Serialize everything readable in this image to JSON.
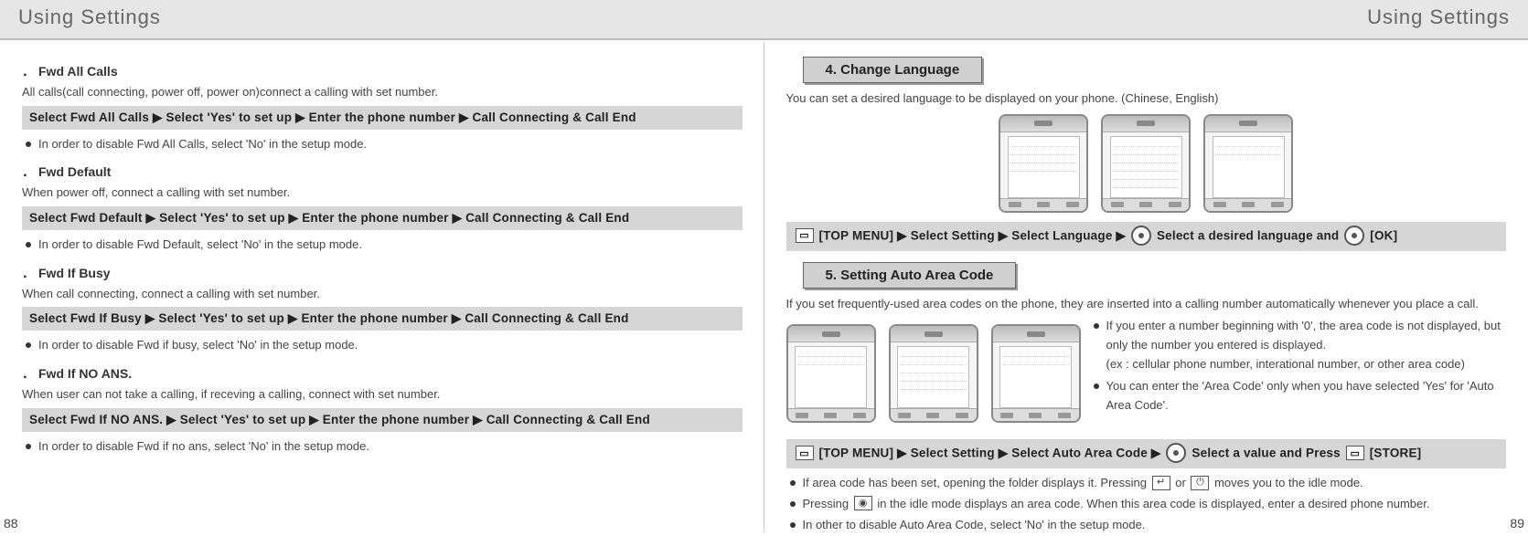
{
  "header": {
    "left_title": "Using Settings",
    "right_title": "Using Settings"
  },
  "page_numbers": {
    "left": "88",
    "right": "89"
  },
  "left": {
    "s1": {
      "prefix": "．",
      "title": "Fwd All Calls",
      "desc": "All calls(call connecting, power off, power on)connect a calling with set number.",
      "instr": "Select Fwd All Calls ▶ Select 'Yes' to set up ▶ Enter the phone number ▶ Call Connecting & Call End",
      "bullet": "In order to disable Fwd All Calls, select 'No' in the setup mode."
    },
    "s2": {
      "prefix": "．",
      "title": "Fwd Default",
      "desc": "When power off, connect a calling with set number.",
      "instr": "Select Fwd Default ▶ Select 'Yes' to set up ▶ Enter the phone number ▶ Call Connecting & Call End",
      "bullet": "In order to disable Fwd Default, select 'No' in the setup mode."
    },
    "s3": {
      "prefix": "．",
      "title": "Fwd If Busy",
      "desc": "When call connecting, connect a calling with set number.",
      "instr": "Select Fwd If Busy ▶ Select 'Yes' to set up ▶ Enter the phone number ▶ Call Connecting & Call End",
      "bullet": "In order to disable Fwd if busy, select 'No' in the setup mode."
    },
    "s4": {
      "prefix": "．",
      "title": "Fwd If NO ANS.",
      "desc": "When user can not take a calling, if receving a calling, connect with set number.",
      "instr": "Select Fwd If NO ANS. ▶ Select 'Yes' to set up ▶ Enter the phone number ▶ Call Connecting & Call End",
      "bullet": "In order to disable Fwd if no ans, select 'No' in the setup mode."
    }
  },
  "right": {
    "sec4": {
      "tab": "4. Change Language",
      "desc": "You can set a desired language to be displayed on your phone. (Chinese, English)",
      "instr_pre": "[TOP MENU] ▶ Select Setting ▶ Select Language ▶",
      "instr_post": "Select a desired language and",
      "instr_end": "[OK]"
    },
    "sec5": {
      "tab": "5. Setting Auto Area Code",
      "desc": "If you set frequently-used area codes on the phone, they are inserted into a calling number automatically whenever you place a call.",
      "notes": {
        "n1": "If you enter a number beginning with '0', the area code is not displayed, but only the number you entered is displayed.",
        "n1b": "(ex : cellular phone number, interational number, or other area code)",
        "n2": "You can enter the 'Area Code' only when you have selected 'Yes' for 'Auto Area Code'."
      },
      "instr_pre": "[TOP MENU] ▶ Select Setting ▶ Select Auto Area Code ▶",
      "instr_post": "Select a value and Press",
      "instr_end": "[STORE]",
      "bullets": {
        "b1a": "If area code has been set, opening the folder displays it. Pressing",
        "b1b": "or",
        "b1c": "moves you to the idle mode.",
        "b2a": "Pressing",
        "b2b": "in the idle mode displays an area code. When this area code is displayed, enter a desired phone number.",
        "b3": "In other to disable Auto Area Code, select 'No' in the setup mode."
      }
    }
  }
}
